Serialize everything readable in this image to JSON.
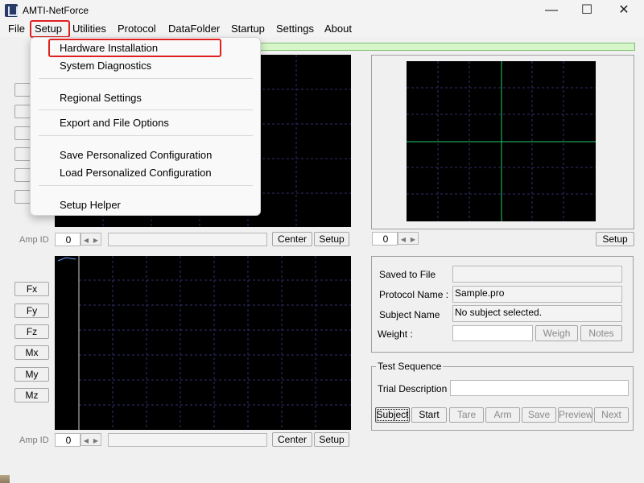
{
  "window": {
    "title": "AMTI-NetForce"
  },
  "menubar": {
    "items": [
      "File",
      "Setup",
      "Utilities",
      "Protocol",
      "DataFolder",
      "Startup",
      "Settings",
      "About"
    ]
  },
  "setup_menu": {
    "items": [
      "Hardware Installation",
      "System Diagnostics",
      "Regional Settings",
      "Export and File Options",
      "Save Personalized Configuration",
      "Load Personalized Configuration",
      "Setup Helper"
    ]
  },
  "force_buttons": [
    "Fx",
    "Fy",
    "Fz",
    "Mx",
    "My",
    "Mz"
  ],
  "top_panel": {
    "amp_label": "Amp ID",
    "amp_value": "0",
    "center_label": "Center",
    "setup_label": "Setup"
  },
  "bottom_panel": {
    "amp_label": "Amp ID",
    "amp_value": "0",
    "center_label": "Center",
    "setup_label": "Setup"
  },
  "cop_panel": {
    "amp_value": "0",
    "setup_label": "Setup"
  },
  "info": {
    "saved_label": "Saved to File",
    "saved_value": "",
    "protocol_label": "Protocol Name :",
    "protocol_value": "Sample.pro",
    "subject_label": "Subject Name",
    "subject_value": "No subject selected.",
    "weight_label": "Weight :",
    "weight_value": "",
    "weigh_button": "Weigh",
    "notes_button": "Notes"
  },
  "test_sequence": {
    "title": "Test Sequence",
    "trial_label": "Trial Description :",
    "trial_value": "",
    "buttons": [
      "Subject",
      "Start",
      "Tare",
      "Arm",
      "Save",
      "Preview",
      "Next"
    ]
  },
  "colors": {
    "highlight": "#e02020",
    "crosshair": "#22cc66",
    "grid": "#2f2f6e",
    "status_bar": "#d6f5c8"
  }
}
